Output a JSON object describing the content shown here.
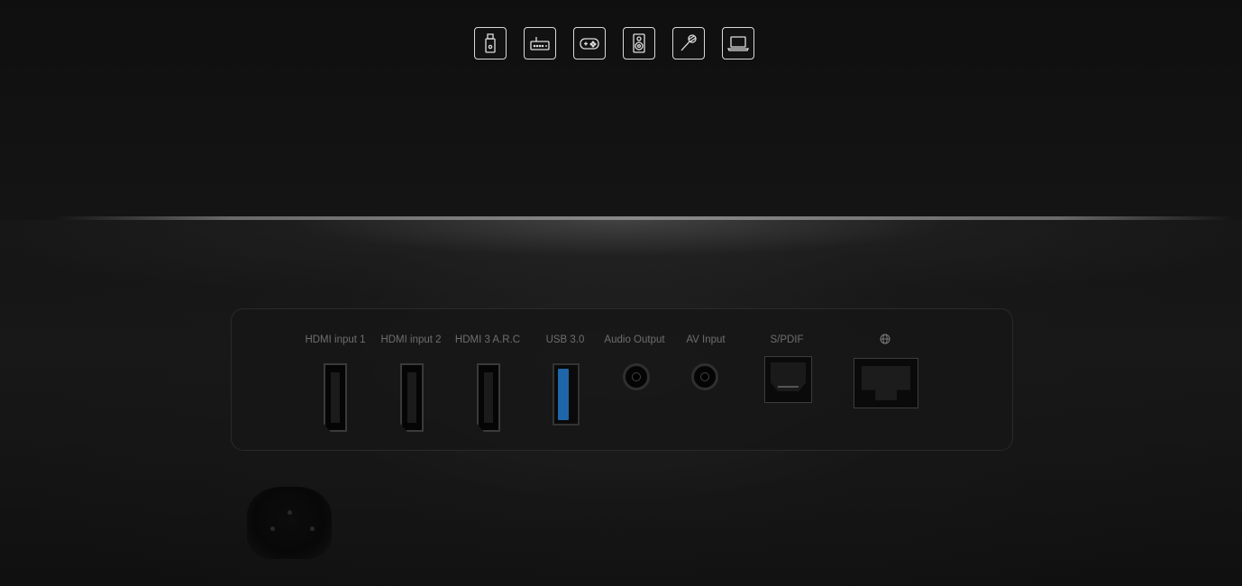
{
  "device_icons": [
    {
      "name": "usb-drive-icon"
    },
    {
      "name": "set-top-box-icon"
    },
    {
      "name": "game-controller-icon"
    },
    {
      "name": "speaker-icon"
    },
    {
      "name": "microphone-icon"
    },
    {
      "name": "laptop-icon"
    }
  ],
  "ports": {
    "hdmi1_label": "HDMI input 1",
    "hdmi2_label": "HDMI input 2",
    "hdmi3_label": "HDMI 3 A.R.C",
    "usb_label": "USB 3.0",
    "audio_out_label": "Audio Output",
    "av_in_label": "AV Input",
    "spdif_label": "S/PDIF"
  },
  "colors": {
    "background": "#141414",
    "icon_stroke": "#d9d9d9",
    "label": "#6e6e6e",
    "usb_accent": "#1f66a8"
  }
}
